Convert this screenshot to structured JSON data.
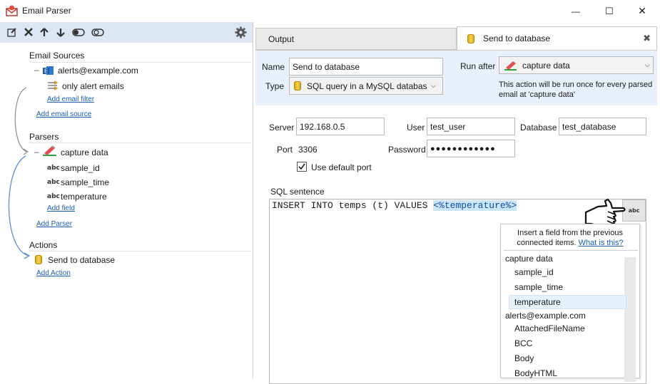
{
  "window": {
    "title": "Email Parser",
    "minimize_glyph": "—",
    "maximize_glyph": "☐",
    "close_glyph": "✕"
  },
  "toolbar": {
    "icons": [
      "edit-icon",
      "delete-icon",
      "move-up-icon",
      "move-down-icon",
      "toggle-on-icon",
      "toggle-off-icon",
      "settings-icon"
    ]
  },
  "tree": {
    "email_sources": {
      "title": "Email Sources",
      "source": "alerts@example.com",
      "filter": "only alert emails",
      "add_filter": "Add email filter",
      "add_source": "Add email source"
    },
    "parsers": {
      "title": "Parsers",
      "parser": "capture data",
      "fields": [
        "sample_id",
        "sample_time",
        "temperature"
      ],
      "add_field": "Add field",
      "add_parser": "Add Parser"
    },
    "actions": {
      "title": "Actions",
      "action": "Send to database",
      "add_action": "Add Action"
    }
  },
  "tabs": {
    "output": "Output",
    "send": "Send to database",
    "close_glyph": "✖"
  },
  "header": {
    "name_label": "Name",
    "name_value": "Send to database",
    "type_label": "Type",
    "type_value": "SQL query in a MySQL databas",
    "run_after_label": "Run after",
    "run_after_value": "capture data",
    "run_note_1": "This action will be run once for every parsed",
    "run_note_2": "email at 'capture data'"
  },
  "connection": {
    "server_label": "Server",
    "server_value": "192.168.0.5",
    "user_label": "User",
    "user_value": "test_user",
    "database_label": "Database",
    "database_value": "test_database",
    "port_label": "Port",
    "port_value": "3306",
    "password_label": "Password",
    "password_value": "●●●●●●●●●●●●",
    "default_port_label": "Use default port",
    "default_port_checked": true
  },
  "sql": {
    "label": "SQL sentence",
    "prefix": "INSERT INTO temps (t) VALUES ",
    "highlight": "<%temperature%>",
    "insert_button": "abc"
  },
  "field_popup": {
    "hint_1": "Insert a field from the previous",
    "hint_2": "connected items.",
    "hint_link": "What is this?",
    "groups": [
      {
        "title": "capture data",
        "items": [
          "sample_id",
          "sample_time",
          "temperature"
        ]
      },
      {
        "title": "alerts@example.com",
        "items": [
          "AttachedFileName",
          "BCC",
          "Body",
          "BodyHTML"
        ]
      }
    ],
    "selected": "temperature"
  },
  "colors": {
    "toolbar_bg": "#dce6f2",
    "header_bg": "#e8f1fb",
    "link": "#1a5fb4",
    "selection": "#cce4f7",
    "connector_arrow": "#5b8fd6"
  }
}
